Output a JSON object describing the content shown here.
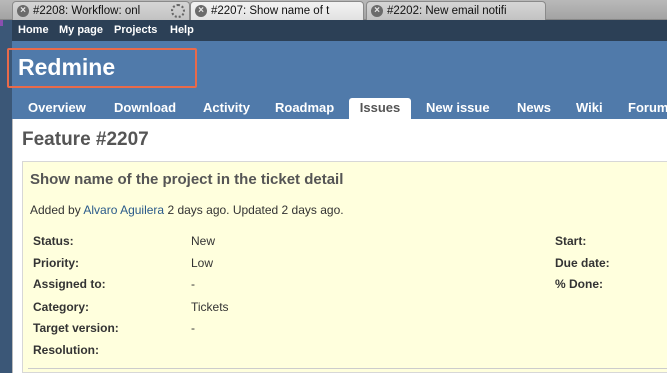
{
  "browser": {
    "tabs": [
      {
        "label": "#2208: Workflow: onl",
        "active": false,
        "loading": true
      },
      {
        "label": "#2207: Show name of t",
        "active": true,
        "loading": false
      },
      {
        "label": "#2202: New email notifi",
        "active": false,
        "loading": false
      }
    ],
    "close_glyph": "×"
  },
  "topmenu": {
    "items": [
      "Home",
      "My page",
      "Projects",
      "Help"
    ]
  },
  "header": {
    "title": "Redmine"
  },
  "mainmenu": {
    "items": [
      "Overview",
      "Download",
      "Activity",
      "Roadmap",
      "Issues",
      "New issue",
      "News",
      "Wiki",
      "Forum"
    ],
    "selected": "Issues"
  },
  "issue": {
    "title": "Feature #2207",
    "subject": "Show name of the project in the ticket detail",
    "added_by_prefix": "Added by",
    "author": "Alvaro Aguilera",
    "added_suffix": "2 days ago. Updated 2 days ago.",
    "attributes": {
      "status_label": "Status:",
      "status_value": "New",
      "priority_label": "Priority:",
      "priority_value": "Low",
      "assigned_label": "Assigned to:",
      "assigned_value": "-",
      "category_label": "Category:",
      "category_value": "Tickets",
      "target_label": "Target version:",
      "target_value": "-",
      "resolution_label": "Resolution:",
      "start_label": "Start:",
      "due_label": "Due date:",
      "done_label": "% Done:"
    }
  },
  "colors": {
    "header_bg": "#507aaa",
    "topmenu_bg": "#2c4056",
    "issue_bg": "#ffffdd",
    "highlight": "#e96a4a"
  }
}
